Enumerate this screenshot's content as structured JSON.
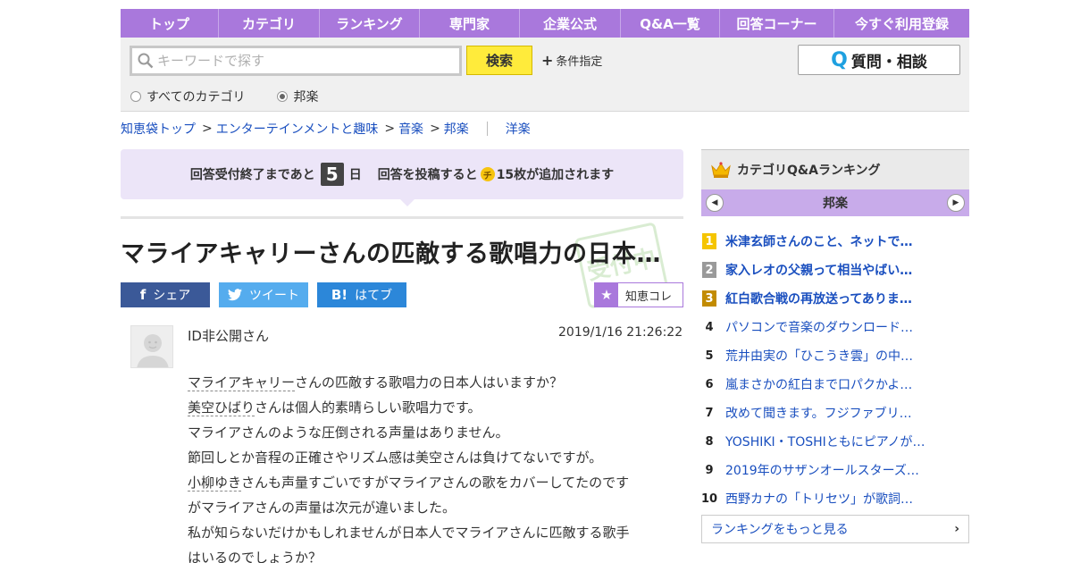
{
  "nav": [
    "トップ",
    "カテゴリ",
    "ランキング",
    "専門家",
    "企業公式",
    "Q&A一覧",
    "回答コーナー",
    "今すぐ利用登録"
  ],
  "search": {
    "placeholder": "キーワードで探す",
    "button": "検索",
    "condition": "条件指定",
    "ask_button": "質問・相談",
    "radio_all": "すべてのカテゴリ",
    "radio_cat": "邦楽"
  },
  "breadcrumb": [
    "知恵袋トップ",
    "エンターテインメントと趣味",
    "音楽",
    "邦楽"
  ],
  "breadcrumb_alt": "洋楽",
  "notice": {
    "prefix": "回答受付終了まであと",
    "days": "5",
    "day_unit": "日",
    "mid": "回答を投稿すると",
    "coin": "チ",
    "suffix": "15枚が追加されます"
  },
  "question": {
    "title": "マライアキャリーさんの匹敵する歌唱力の日本…",
    "stamp": "受付中",
    "user": "ID非公開さん",
    "date": "2019/1/16  21:26:22",
    "lines": [
      {
        "kw": "マライアキャリー",
        "rest": "さんの匹敵する歌唱力の日本人はいますか？"
      },
      {
        "kw": "美空ひばり",
        "rest": "さんは個人的素晴らしい歌唱力です。"
      },
      {
        "kw": "",
        "rest": "マライアさんのような圧倒される声量はありません。"
      },
      {
        "kw": "",
        "rest": "節回しとか音程の正確さやリズム感は美空さんは負けてないですが。"
      },
      {
        "kw": "小柳ゆき",
        "rest": "さんも声量すごいですがマライアさんの歌をカバーしてたのです"
      },
      {
        "kw": "",
        "rest": "がマライアさんの声量は次元が違いました。"
      },
      {
        "kw": "",
        "rest": "私が知らないだけかもしれませんが日本人でマライアさんに匹敵する歌手"
      },
      {
        "kw": "",
        "rest": "はいるのでしょうか？"
      }
    ]
  },
  "share": {
    "facebook": "シェア",
    "twitter": "ツイート",
    "hatena": "はてブ",
    "hatena_icon": "B!",
    "fav": "知恵コレ"
  },
  "ranking": {
    "title": "カテゴリQ&Aランキング",
    "category": "邦楽",
    "items": [
      {
        "rank": "1",
        "text": "米津玄師さんのこと、ネットで…"
      },
      {
        "rank": "2",
        "text": "家入レオの父親って相当やばい…"
      },
      {
        "rank": "3",
        "text": "紅白歌合戦の再放送ってありま…"
      },
      {
        "rank": "4",
        "text": "パソコンで音楽のダウンロード…"
      },
      {
        "rank": "5",
        "text": "荒井由実の「ひこうき雲」の中…"
      },
      {
        "rank": "6",
        "text": "嵐まさかの紅白まで口パクかよ…"
      },
      {
        "rank": "7",
        "text": "改めて聞きます。フジファブリ…"
      },
      {
        "rank": "8",
        "text": "YOSHIKI・TOSHIともにピアノが…"
      },
      {
        "rank": "9",
        "text": "2019年のサザンオールスターズ…"
      },
      {
        "rank": "10",
        "text": "西野カナの「トリセツ」が歌詞…"
      }
    ],
    "more": "ランキングをもっと見る"
  },
  "colors": {
    "nav": "#a978dc",
    "notice_bg": "#ece5f8",
    "link": "#1a4fbf",
    "search_btn": "#ffeb3b"
  }
}
